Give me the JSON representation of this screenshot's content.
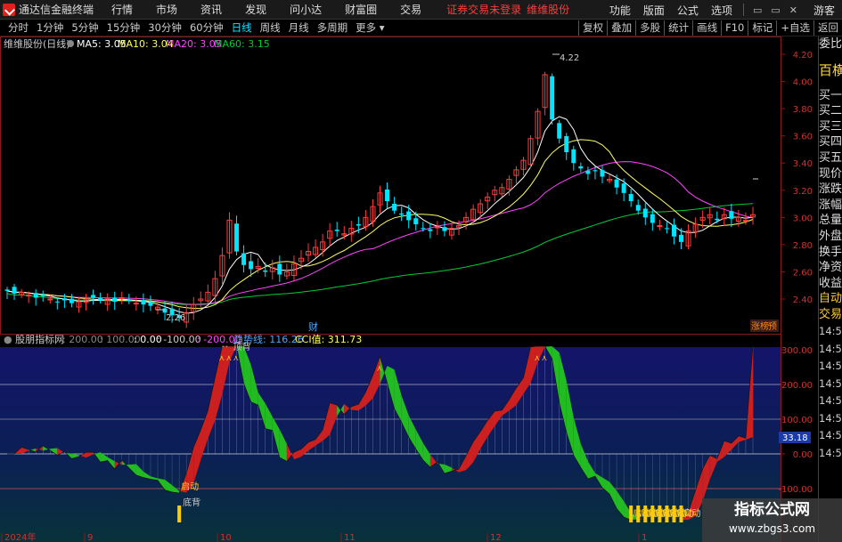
{
  "titlebar": {
    "app_name": "通达信金融终端",
    "menus": [
      "行情",
      "市场",
      "资讯",
      "发现",
      "问小达",
      "财富圈",
      "交易"
    ],
    "warning": "证券交易未登录",
    "stock_name": "维维股份",
    "right_menus": [
      "功能",
      "版面",
      "公式",
      "选项"
    ],
    "guest": "游客"
  },
  "periodbar": {
    "periods": [
      "分时",
      "1分钟",
      "5分钟",
      "15分钟",
      "30分钟",
      "60分钟",
      "日线",
      "周线",
      "月线",
      "多周期",
      "更多"
    ],
    "active": "日线",
    "tools": [
      "复权",
      "叠加",
      "多股",
      "统计",
      "画线",
      "F10",
      "标记",
      "+自选",
      "返回"
    ]
  },
  "main_legend": {
    "title": "维维股份(日线)",
    "ma5": "MA5: 3.05",
    "ma10": "MA10: 3.04",
    "ma20": "MA20: 3.05",
    "ma60": "MA60: 3.15"
  },
  "price_axis": [
    "4.20",
    "4.00",
    "3.80",
    "3.60",
    "3.40",
    "3.20",
    "3.00",
    "2.80",
    "2.60",
    "2.40"
  ],
  "annotations": {
    "high": "4.22",
    "low": "2.26",
    "finance_mark": "财",
    "zdt": "涨榜",
    "yu": "预"
  },
  "sub_legend": {
    "title": "股朋指标网",
    "v200": ": 200.00",
    "v100": ": 100.00",
    "v0": ": 0.00",
    "vm100": ": -100.00",
    "vm200": ": -200.00",
    "trend": "趋势线: 116.26",
    "cci": "CCI值: 311.73"
  },
  "sub_axis": [
    "300.00",
    "200.00",
    "100.00",
    "0.00",
    "-100.00"
  ],
  "sub_current": "33.18",
  "sub_labels": {
    "top_div": "顶背",
    "bottom_div": "底背",
    "start": "启动"
  },
  "date_axis": [
    "2024年",
    "9",
    "10",
    "11",
    "12",
    "1"
  ],
  "sidebar": {
    "top": "委比",
    "big": "百横",
    "items": [
      "买一",
      "买二",
      "买三",
      "买四",
      "买五",
      "现价",
      "涨跌",
      "涨幅",
      "总量",
      "外盘",
      "换手",
      "净资",
      "收益"
    ],
    "auto": [
      "自动",
      "交易"
    ],
    "times": [
      "14:56",
      "14:56",
      "14:56",
      "14:56",
      "14:56",
      "14:56",
      "14:56",
      "14:56"
    ]
  },
  "watermark": {
    "line1": "指标公式网",
    "line2": "www.zbgs3.com"
  },
  "colors": {
    "up": "#ff3b3b",
    "down": "#00e5ff",
    "ma5": "#ffffff",
    "ma10": "#ffff66",
    "ma20": "#ff44ff",
    "ma60": "#00cc33",
    "bull_fill": "#cc1f1f",
    "bear_fill": "#22bb22",
    "active_period": "#00e5ff"
  },
  "chart_data": {
    "type": "candlestick",
    "ohlc_close_sample": [
      2.46,
      2.44,
      2.45,
      2.43,
      2.41,
      2.42,
      2.4,
      2.38,
      2.39,
      2.37,
      2.38,
      2.4,
      2.41,
      2.39,
      2.4,
      2.38,
      2.41,
      2.39,
      2.37,
      2.36,
      2.35,
      2.34,
      2.3,
      2.28,
      2.26,
      2.3,
      2.36,
      2.4,
      2.45,
      2.55,
      2.72,
      2.98,
      2.75,
      2.65,
      2.62,
      2.64,
      2.6,
      2.63,
      2.58,
      2.6,
      2.66,
      2.7,
      2.75,
      2.78,
      2.82,
      2.9,
      2.9,
      2.88,
      2.92,
      2.94,
      3.0,
      3.08,
      3.18,
      3.12,
      3.05,
      3.02,
      2.98,
      2.95,
      2.92,
      2.9,
      2.93,
      2.9,
      2.92,
      2.94,
      3.0,
      3.06,
      3.1,
      3.15,
      3.2,
      3.22,
      3.28,
      3.35,
      3.42,
      3.58,
      3.78,
      4.05,
      3.72,
      3.58,
      3.48,
      3.4,
      3.36,
      3.32,
      3.34,
      3.3,
      3.28,
      3.22,
      3.18,
      3.12,
      3.05,
      3.0,
      2.96,
      2.94,
      2.92,
      2.86,
      2.82,
      2.9,
      2.95,
      3.0,
      3.02,
      2.98,
      3.02,
      2.99,
      3.0,
      2.98,
      3.02
    ]
  }
}
